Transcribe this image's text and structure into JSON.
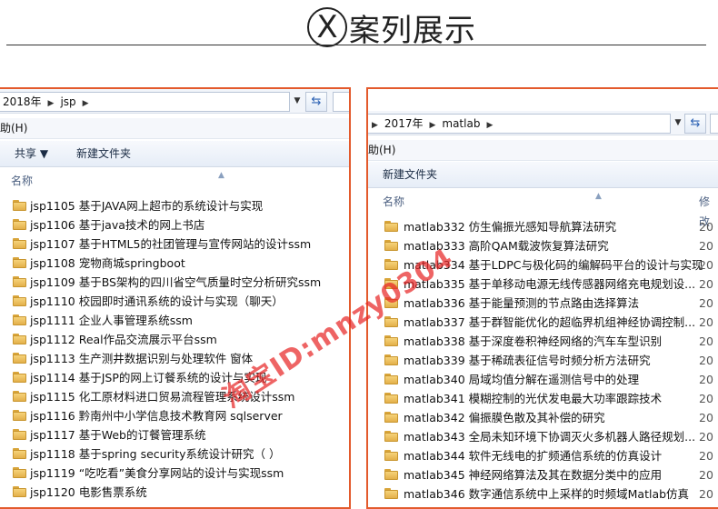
{
  "header": {
    "circle_letter": "X",
    "title": "案列展示"
  },
  "watermark": "淘宝ID:mnzy0304",
  "left_window": {
    "address": [
      "2018年",
      "jsp"
    ],
    "menu": "助(H)",
    "toolbar": {
      "share": "共享 ▼",
      "new_folder": "新建文件夹"
    },
    "column_name": "名称",
    "folders": [
      "jsp1105 基于JAVA网上超市的系统设计与实现",
      "jsp1106 基于java技术的网上书店",
      "jsp1107 基于HTML5的社团管理与宣传网站的设计ssm",
      "jsp1108 宠物商城springboot",
      "jsp1109 基于BS架构的四川省空气质量时空分析研究ssm",
      "jsp1110 校园即时通讯系统的设计与实现（聊天）",
      "jsp1111 企业人事管理系统ssm",
      "jsp1112 Real作品交流展示平台ssm",
      "jsp1113 生产测井数据识别与处理软件 窗体",
      "jsp1114 基于JSP的网上订餐系统的设计与实现",
      "jsp1115 化工原材料进口贸易流程管理系统设计ssm",
      "jsp1116 黔南州中小学信息技术教育网 sqlserver",
      "jsp1117 基于Web的订餐管理系统",
      "jsp1118 基于spring security系统设计研究（ ）",
      "jsp1119 “吃吃看”美食分享网站的设计与实现ssm",
      "jsp1120 电影售票系统"
    ]
  },
  "right_window": {
    "address": [
      "2017年",
      "matlab"
    ],
    "menu": "助(H)",
    "toolbar": {
      "new_folder": "新建文件夹"
    },
    "column_name": "名称",
    "column_date": "修改",
    "date_prefix": "20",
    "folders": [
      "matlab332 仿生偏振光感知导航算法研究",
      "matlab333 高阶QAM载波恢复算法研究",
      "matlab334 基于LDPC与极化码的编解码平台的设计与实现",
      "matlab335 基于单移动电源无线传感器网络充电规划设...",
      "matlab336 基于能量预测的节点路由选择算法",
      "matlab337 基于群智能优化的超临界机组神经协调控制...",
      "matlab338 基于深度卷积神经网络的汽车车型识别",
      "matlab339 基于稀疏表征信号时频分析方法研究",
      "matlab340 局域均值分解在遥测信号中的处理",
      "matlab341 模糊控制的光伏发电最大功率跟踪技术",
      "matlab342 偏振膜色散及其补偿的研究",
      "matlab343 全局未知环境下协调灭火多机器人路径规划...",
      "matlab344 软件无线电的扩频通信系统的仿真设计",
      "matlab345 神经网络算法及其在数据分类中的应用",
      "matlab346 数字通信系统中上采样的时频域Matlab仿真"
    ]
  }
}
